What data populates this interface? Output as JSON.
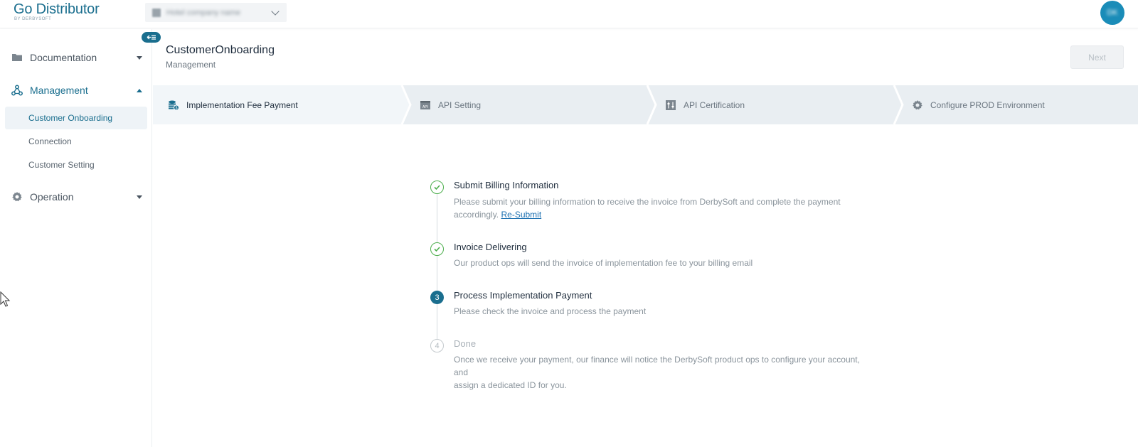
{
  "app": {
    "logo_main": "Go Distributor",
    "logo_sub": "BY DERBYSOFT",
    "company_select_value": "Hotel company name",
    "avatar_initials": "DK",
    "collapse_icon": "collapse-sidebar-icon"
  },
  "sidebar": {
    "groups": [
      {
        "label": "Documentation",
        "icon": "folder-icon",
        "expanded": false
      },
      {
        "label": "Management",
        "icon": "management-icon",
        "expanded": true
      },
      {
        "label": "Operation",
        "icon": "gear-icon",
        "expanded": false
      }
    ],
    "management_items": [
      {
        "label": "Customer Onboarding",
        "selected": true
      },
      {
        "label": "Connection",
        "selected": false
      },
      {
        "label": "Customer Setting",
        "selected": false
      }
    ]
  },
  "header": {
    "title": "CustomerOnboarding",
    "subtitle": "Management",
    "next_label": "Next"
  },
  "steps": [
    {
      "label": "Implementation Fee Payment",
      "icon": "coins-icon",
      "active": true
    },
    {
      "label": "API Setting",
      "icon": "api-icon",
      "active": false
    },
    {
      "label": "API Certification",
      "icon": "sliders-icon",
      "active": false
    },
    {
      "label": "Configure PROD Environment",
      "icon": "gear-icon",
      "active": false
    }
  ],
  "timeline": [
    {
      "status": "done",
      "title": "Submit Billing Information",
      "desc_line1": "Please submit your billing information to receive the invoice from DerbySoft and complete the payment",
      "desc_line2": "accordingly.",
      "link": "Re-Submit"
    },
    {
      "status": "done",
      "title": "Invoice Delivering",
      "desc_line1": "Our product ops will send the invoice of implementation fee to your billing email"
    },
    {
      "status": "current",
      "number": "3",
      "title": "Process Implementation Payment",
      "desc_line1": "Please check the invoice and process the payment"
    },
    {
      "status": "pending",
      "number": "4",
      "title": "Done",
      "desc_line1": "Once we receive your payment, our finance will notice the DerbySoft product ops to configure your account, and",
      "desc_line2": "assign a dedicated ID for you."
    }
  ],
  "colors": {
    "brand": "#1a6e8e",
    "success": "#4cae4c",
    "link": "#1a6fb0"
  }
}
